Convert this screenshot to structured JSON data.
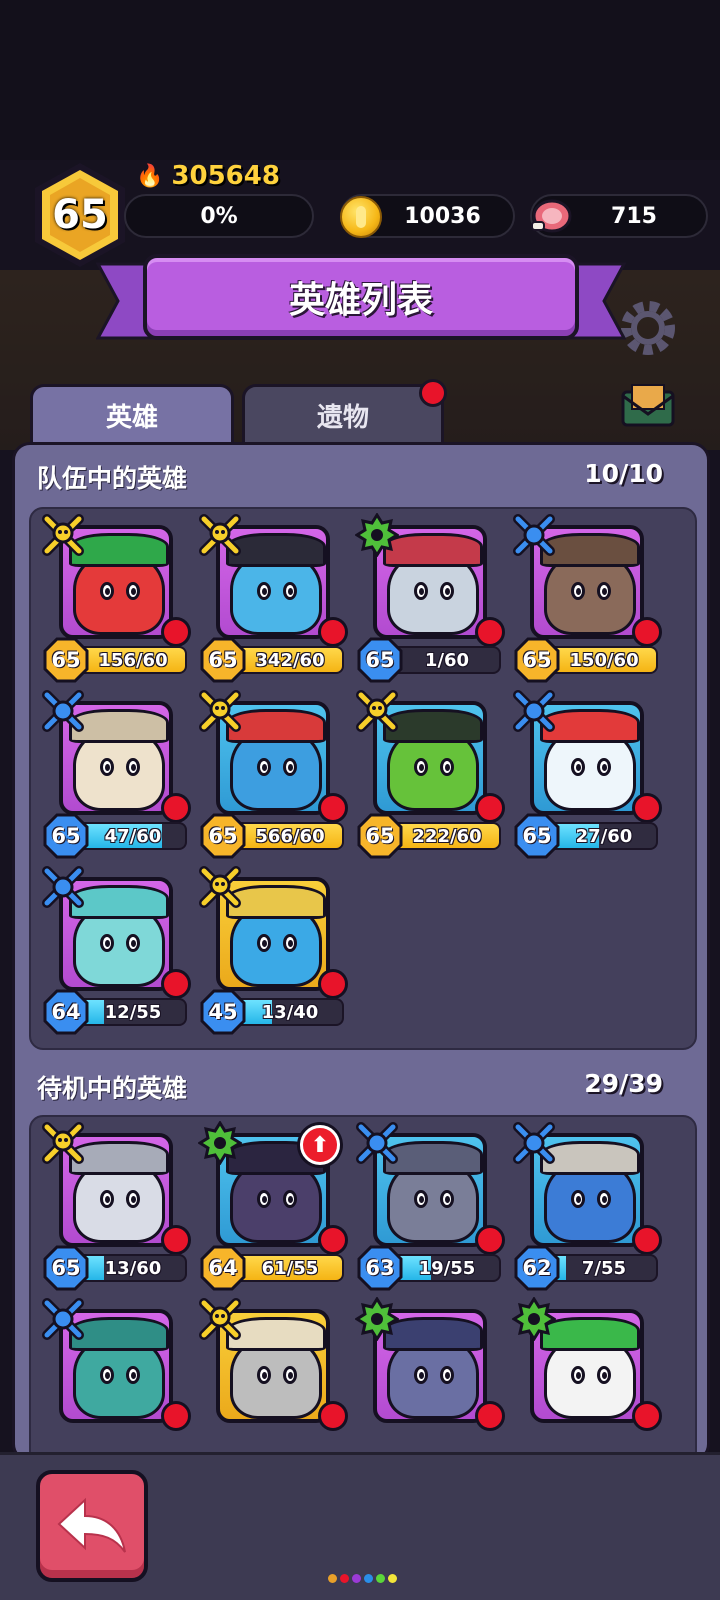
{
  "header": {
    "level": "65",
    "power": "305648",
    "xp_percent": "0%",
    "coins": "10036",
    "meat": "715"
  },
  "title": "英雄列表",
  "tabs": [
    {
      "label": "英雄",
      "active": true
    },
    {
      "label": "遗物",
      "active": false,
      "has_notification": true
    }
  ],
  "team_section": {
    "title": "队伍中的英雄",
    "count": "10/10",
    "heroes": [
      {
        "class": "melee-yellow",
        "level": "65",
        "progress": "156/60",
        "bar": "gold",
        "fill": 1.0,
        "frame": "purple",
        "icon": "green-hat-ninja"
      },
      {
        "class": "melee-yellow",
        "level": "65",
        "progress": "342/60",
        "bar": "gold",
        "fill": 1.0,
        "frame": "purple",
        "icon": "skull-helmet-blob"
      },
      {
        "class": "support-green",
        "level": "65",
        "progress": "1/60",
        "bar": "cyan",
        "fill": 0.02,
        "frame": "purple",
        "icon": "robot-drill"
      },
      {
        "class": "ranged-blue",
        "level": "65",
        "progress": "150/60",
        "bar": "gold",
        "fill": 1.0,
        "frame": "purple",
        "icon": "tree-stump"
      },
      {
        "class": "ranged-blue",
        "level": "65",
        "progress": "47/60",
        "bar": "cyan",
        "fill": 0.78,
        "frame": "purple",
        "icon": "mummy"
      },
      {
        "class": "melee-yellow",
        "level": "65",
        "progress": "566/60",
        "bar": "gold",
        "fill": 1.0,
        "frame": "blue",
        "icon": "horned-warrior"
      },
      {
        "class": "melee-yellow",
        "level": "65",
        "progress": "222/60",
        "bar": "gold",
        "fill": 1.0,
        "frame": "blue",
        "icon": "green-cat"
      },
      {
        "class": "ranged-blue",
        "level": "65",
        "progress": "27/60",
        "bar": "cyan",
        "fill": 0.45,
        "frame": "blue",
        "icon": "snowman"
      },
      {
        "class": "ranged-blue",
        "level": "64",
        "progress": "12/55",
        "bar": "cyan",
        "fill": 0.22,
        "frame": "purple",
        "icon": "bunny"
      },
      {
        "class": "melee-yellow",
        "level": "45",
        "progress": "13/40",
        "bar": "cyan",
        "fill": 0.33,
        "frame": "yellow",
        "icon": "armored-knight"
      }
    ]
  },
  "standby_section": {
    "title": "待机中的英雄",
    "count": "29/39",
    "heroes": [
      {
        "class": "melee-yellow",
        "level": "65",
        "progress": "13/60",
        "bar": "cyan",
        "fill": 0.22,
        "frame": "purple",
        "icon": "knight-helmet"
      },
      {
        "class": "support-green",
        "level": "64",
        "progress": "61/55",
        "bar": "gold",
        "fill": 1.0,
        "frame": "blue",
        "icon": "dark-robot",
        "upgrade": true
      },
      {
        "class": "ranged-blue",
        "level": "63",
        "progress": "19/55",
        "bar": "cyan",
        "fill": 0.35,
        "frame": "blue",
        "icon": "storm-cloud"
      },
      {
        "class": "ranged-blue",
        "level": "62",
        "progress": "7/55",
        "bar": "cyan",
        "fill": 0.13,
        "frame": "blue",
        "icon": "spiked-shell"
      },
      {
        "class": "ranged-blue",
        "level": "",
        "progress": "",
        "bar": "cyan",
        "fill": 0,
        "frame": "purple",
        "icon": "teal-monster"
      },
      {
        "class": "melee-yellow",
        "level": "",
        "progress": "",
        "bar": "cyan",
        "fill": 0,
        "frame": "yellow",
        "icon": "grey-helmet"
      },
      {
        "class": "support-green",
        "level": "",
        "progress": "",
        "bar": "cyan",
        "fill": 0,
        "frame": "purple",
        "icon": "shark-robot"
      },
      {
        "class": "support-green",
        "level": "",
        "progress": "",
        "bar": "cyan",
        "fill": 0,
        "frame": "purple",
        "icon": "leaf-robot"
      }
    ]
  },
  "colors": {
    "panel": "#6e6a95",
    "title_banner": "#b95ee0",
    "gold_bar": "#f5b414",
    "cyan_bar": "#25b6e8",
    "notification": "#e8142a"
  },
  "page_dots": [
    "#e8a02a",
    "#e8142a",
    "#9b3ad6",
    "#2a8ee8",
    "#5bd63a",
    "#f3e53a"
  ]
}
